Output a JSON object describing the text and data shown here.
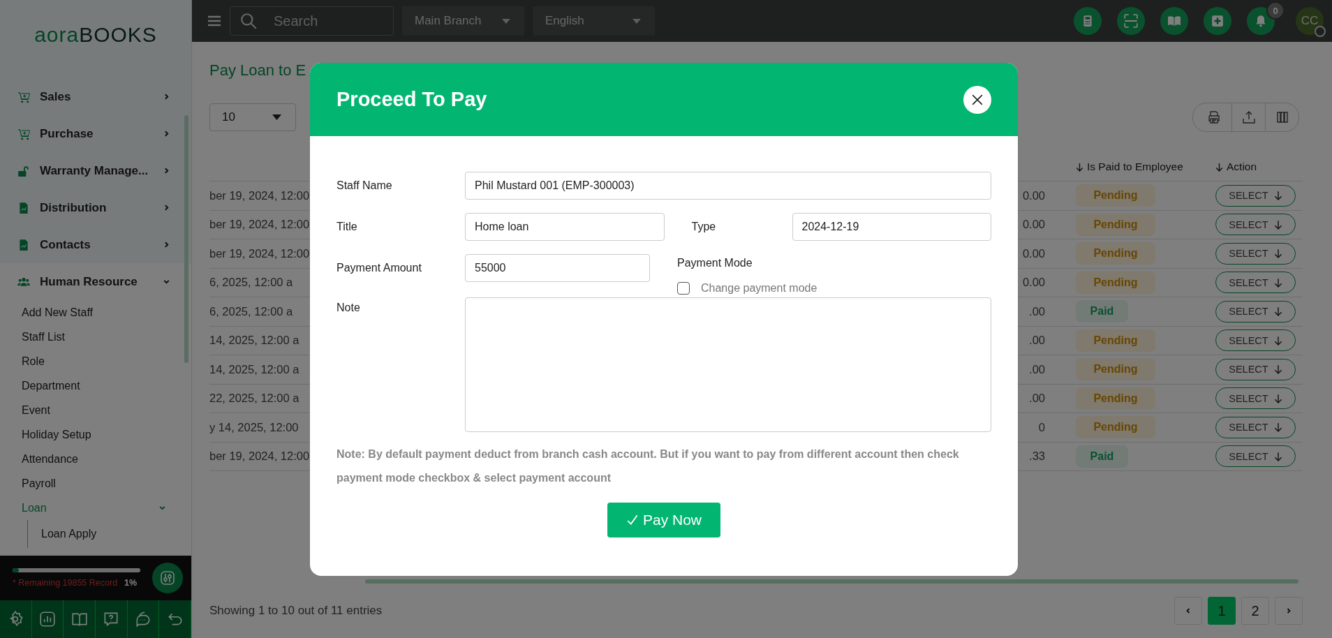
{
  "sidebar": {
    "logo": {
      "part_1": "aora",
      "part_2": "BOOKS"
    },
    "items": [
      {
        "label": "Sales",
        "expanded": false
      },
      {
        "label": "Purchase",
        "expanded": false
      },
      {
        "label": "Warranty Manage...",
        "expanded": false
      },
      {
        "label": "Distribution",
        "expanded": false
      },
      {
        "label": "Contacts",
        "expanded": false
      },
      {
        "label": "Human Resource",
        "expanded": true,
        "children": [
          {
            "label": "Add New Staff",
            "selected": false
          },
          {
            "label": "Staff List",
            "selected": false
          },
          {
            "label": "Role",
            "selected": false
          },
          {
            "label": "Department",
            "selected": false
          },
          {
            "label": "Event",
            "selected": false
          },
          {
            "label": "Holiday Setup",
            "selected": false
          },
          {
            "label": "Attendance",
            "selected": false
          },
          {
            "label": "Payroll",
            "selected": false
          },
          {
            "label": "Loan",
            "selected": true,
            "expanded": true,
            "children": [
              {
                "label": "Loan Apply",
                "selected": false
              }
            ]
          }
        ]
      }
    ],
    "usage": {
      "remaining": "* Remaining 19855 Record",
      "percent": "1%",
      "level": 0.05
    }
  },
  "topbar": {
    "search": {
      "placeholder": "Search"
    },
    "branch": "Main Branch",
    "language": "English",
    "notification_count": "0",
    "avatar": "CC"
  },
  "page": {
    "title": "Pay Loan to E",
    "page_size": "10",
    "columns": [
      {
        "label": "Is Paid to Employee"
      },
      {
        "label": "Action"
      }
    ],
    "rows": [
      {
        "date": "ber 19, 2024, 12:00",
        "amount": "0.00",
        "status": "Pending",
        "kind": "pending",
        "action": "SELECT"
      },
      {
        "date": "ber 19, 2024, 12:00",
        "amount": "0.00",
        "status": "Pending",
        "kind": "pending",
        "action": "SELECT"
      },
      {
        "date": "ber 19, 2024, 12:00",
        "amount": "0.00",
        "status": "Pending",
        "kind": "pending",
        "action": "SELECT"
      },
      {
        "date": "6, 2025, 12:00 a",
        "amount": "0.00",
        "status": "Pending",
        "kind": "pending",
        "action": "SELECT"
      },
      {
        "date": "6, 2025, 12:00 a",
        "amount": ".00",
        "status": "Paid",
        "kind": "paid",
        "action": "SELECT"
      },
      {
        "date": "14, 2025, 12:00 a",
        "amount": ".00",
        "status": "Pending",
        "kind": "pending",
        "action": "SELECT"
      },
      {
        "date": "14, 2025, 12:00 a",
        "amount": ".00",
        "status": "Pending",
        "kind": "pending",
        "action": "SELECT"
      },
      {
        "date": "22, 2025, 12:00 a",
        "amount": ".00",
        "status": "Pending",
        "kind": "pending",
        "action": "SELECT"
      },
      {
        "date": "y 14, 2025, 12:00",
        "amount": "0",
        "status": "Pending",
        "kind": "pending",
        "action": "SELECT"
      },
      {
        "date": "ber 19, 2024, 12:00",
        "amount": ".33",
        "status": "Paid",
        "kind": "paid",
        "action": "SELECT"
      }
    ],
    "summary": "Showing 1 to 10 out of 11 entries",
    "pages": [
      {
        "label": "1",
        "selected": true
      },
      {
        "label": "2",
        "selected": false
      }
    ]
  },
  "modal": {
    "title": "Proceed To Pay",
    "staff_name": {
      "label": "Staff Name",
      "value": "Phil Mustard 001 (EMP-300003)"
    },
    "title_field": {
      "label": "Title",
      "value": "Home loan"
    },
    "type": {
      "label": "Type",
      "value": "2024-12-19"
    },
    "payment_amount": {
      "label": "Payment Amount",
      "value": "55000"
    },
    "payment_mode": {
      "label": "Payment Mode",
      "option": "Change payment mode",
      "checked": false
    },
    "note": {
      "label": "Note"
    },
    "hint": "Note: By default payment deduct from branch cash account. But if you want to pay from different account then check payment mode checkbox & select payment account",
    "submit": "Pay Now"
  }
}
